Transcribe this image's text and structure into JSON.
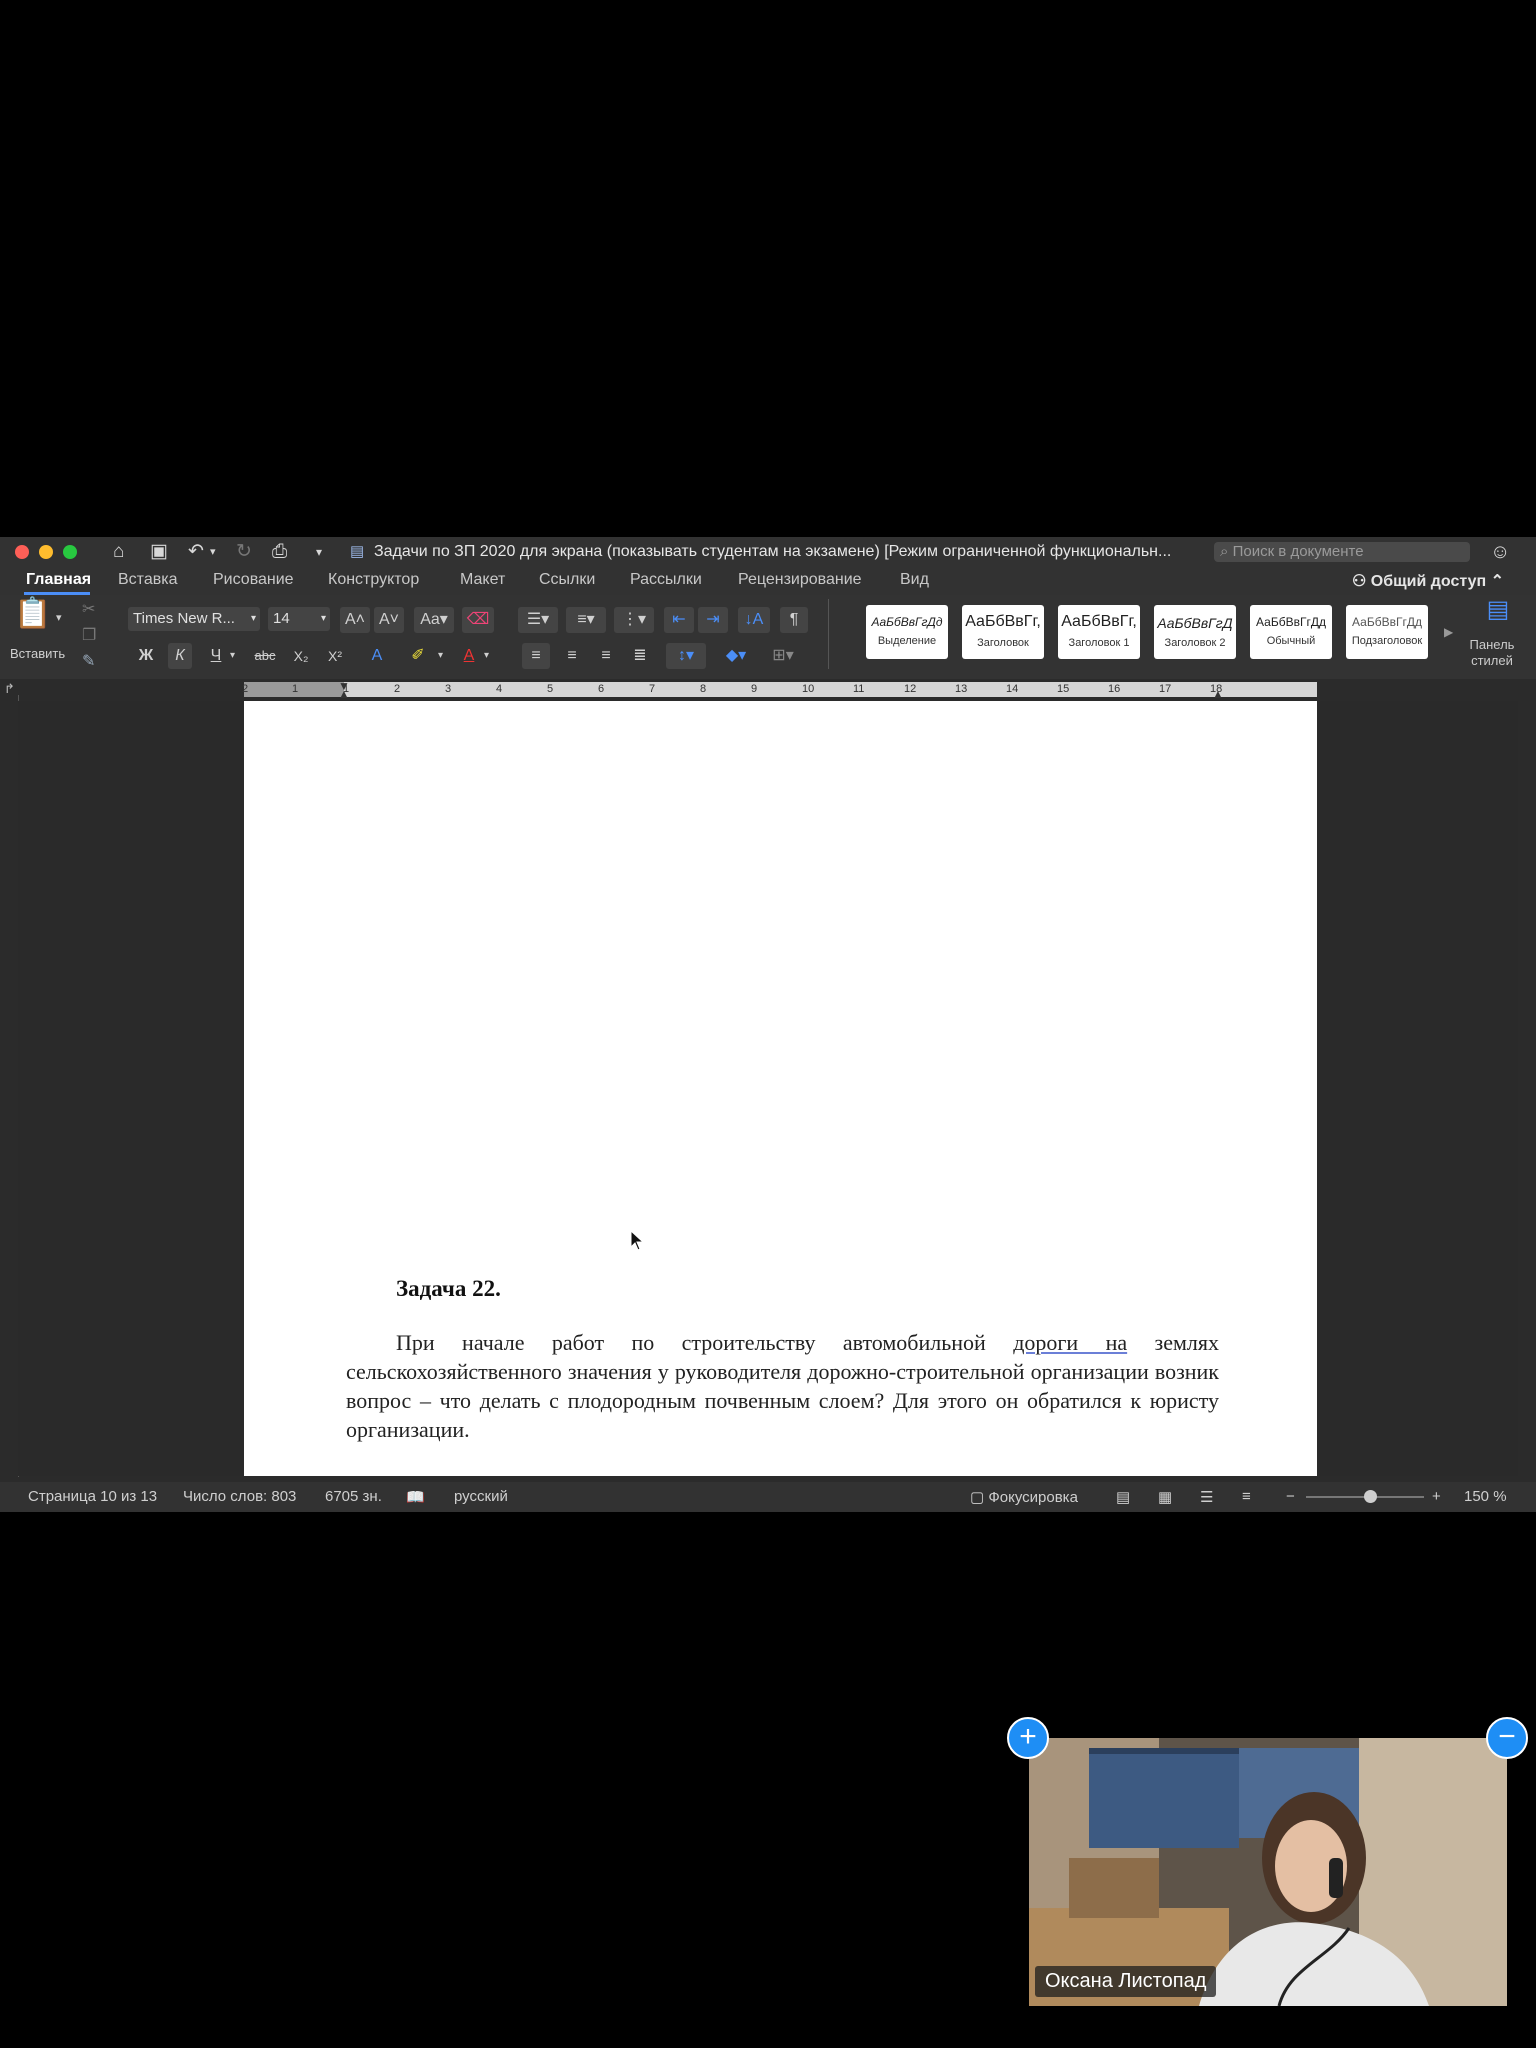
{
  "window": {
    "title": "Задачи по ЗП 2020 для экрана (показывать студентам на экзамене) [Режим ограниченной функциональн...",
    "search_placeholder": "Поиск в документе"
  },
  "tabs": [
    {
      "label": "Главная",
      "active": true
    },
    {
      "label": "Вставка"
    },
    {
      "label": "Рисование"
    },
    {
      "label": "Конструктор"
    },
    {
      "label": "Макет"
    },
    {
      "label": "Ссылки"
    },
    {
      "label": "Рассылки"
    },
    {
      "label": "Рецензирование"
    },
    {
      "label": "Вид"
    }
  ],
  "share_label": "Общий доступ",
  "ribbon": {
    "paste_label": "Вставить",
    "font_name": "Times New R...",
    "font_size": "14",
    "bold": "Ж",
    "italic": "К",
    "underline": "Ч",
    "strike": "abc",
    "sub": "X₂",
    "sup": "X²",
    "pilcrow": "¶",
    "styles_pane": "Панель стилей",
    "styles": [
      {
        "sample": "АаБбВвГгДд",
        "name": "Выделение"
      },
      {
        "sample": "АаБбВвГг,",
        "name": "Заголовок"
      },
      {
        "sample": "АаБбВвГг,",
        "name": "Заголовок 1"
      },
      {
        "sample": "АаБбВвГгД",
        "name": "Заголовок 2"
      },
      {
        "sample": "АаБбВвГгДд",
        "name": "Обычный"
      },
      {
        "sample": "АаБбВвГгДд",
        "name": "Подзаголовок"
      }
    ]
  },
  "ruler_numbers": [
    "2",
    "1",
    "1",
    "2",
    "3",
    "4",
    "5",
    "6",
    "7",
    "8",
    "9",
    "10",
    "11",
    "12",
    "13",
    "14",
    "15",
    "16",
    "17",
    "18"
  ],
  "document": {
    "task_title": "Задача 22.",
    "task_text_a": "При начале работ по строительству автомобильной ",
    "task_text_spell": "дороги  на",
    "task_text_b": " землях сельскохозяйственного  значения у руководителя дорожно-строительной организации возник вопрос – что делать с плодородным почвенным слоем? Для этого он обратился к юристу организации."
  },
  "status": {
    "page": "Страница 10 из 13",
    "words": "Число слов: 803",
    "chars": "6705 зн.",
    "language": "русский",
    "focus": "Фокусировка",
    "zoom": "150 %"
  },
  "video": {
    "participant": "Оксана Листопад"
  },
  "colors": {
    "accent": "#4b8ef7",
    "video_button": "#1e8ef5"
  }
}
